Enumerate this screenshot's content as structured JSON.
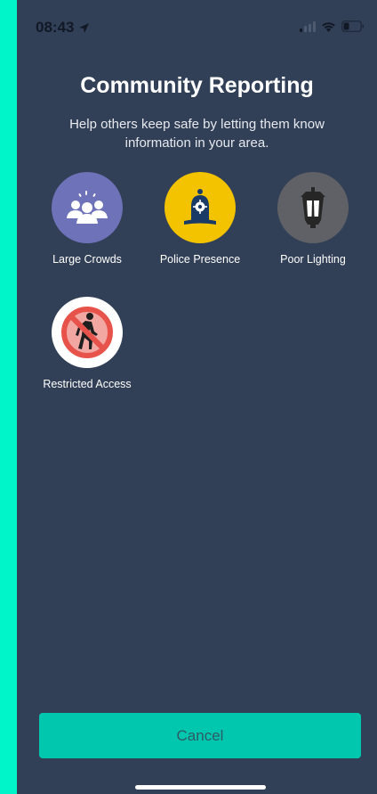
{
  "status_bar": {
    "time": "08:43",
    "icons": [
      "location-arrow-icon",
      "cellular-signal-icon",
      "wifi-icon",
      "battery-icon"
    ]
  },
  "header": {
    "title": "Community Reporting",
    "subtitle": "Help others keep safe by letting them know information in your area."
  },
  "report_types": [
    {
      "label": "Large Crowds",
      "icon": "crowd-icon",
      "color": "#6e72b8"
    },
    {
      "label": "Police Presence",
      "icon": "police-helmet-icon",
      "color": "#f3c300"
    },
    {
      "label": "Poor Lighting",
      "icon": "street-lamp-icon",
      "color": "#606166"
    },
    {
      "label": "Restricted Access",
      "icon": "no-pedestrian-icon",
      "color": "#ffffff"
    }
  ],
  "footer": {
    "cancel_label": "Cancel"
  },
  "colors": {
    "background": "#324057",
    "accent": "#00c7ae",
    "frame": "#00f5c8"
  }
}
